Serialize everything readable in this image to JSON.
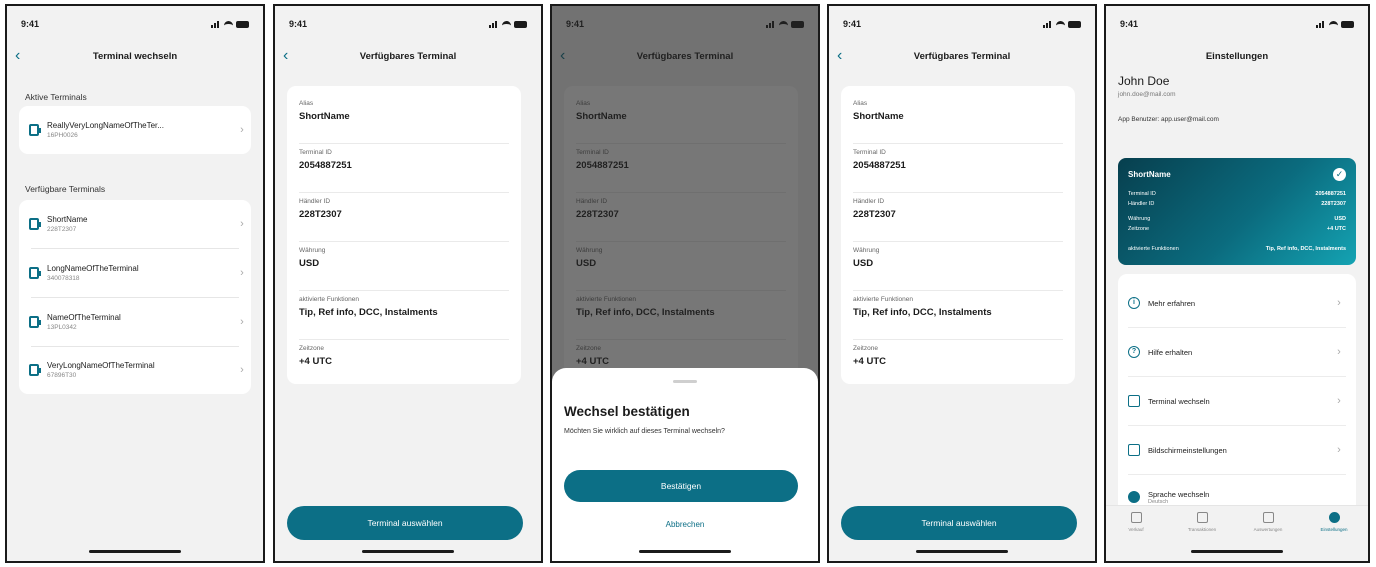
{
  "status_time": "9:41",
  "screen1": {
    "title": "Terminal wechseln",
    "active_label": "Aktive Terminals",
    "active": [
      {
        "name": "ReallyVeryLongNameOfTheTer...",
        "id": "16PH0026"
      }
    ],
    "available_label": "Verfügbare Terminals",
    "available": [
      {
        "name": "ShortName",
        "id": "228T2307"
      },
      {
        "name": "LongNameOfTheTerminal",
        "id": "340078318"
      },
      {
        "name": "NameOfTheTerminal",
        "id": "13PL0342"
      },
      {
        "name": "VeryLongNameOfTheTerminal",
        "id": "67896T30"
      }
    ]
  },
  "detail": {
    "title": "Verfügbares Terminal",
    "fields": [
      {
        "label": "Alias",
        "value": "ShortName"
      },
      {
        "label": "Terminal ID",
        "value": "2054887251"
      },
      {
        "label": "Händler ID",
        "value": "228T2307"
      },
      {
        "label": "Währung",
        "value": "USD"
      },
      {
        "label": "aktivierte Funktionen",
        "value": "Tip, Ref info, DCC, Instalments"
      },
      {
        "label": "Zeitzone",
        "value": "+4 UTC"
      }
    ],
    "button": "Terminal auswählen"
  },
  "sheet": {
    "title": "Wechsel bestätigen",
    "description": "Möchten Sie wirklich auf dieses Terminal wechseln?",
    "confirm": "Bestätigen",
    "cancel": "Abbrechen"
  },
  "settings": {
    "title": "Einstellungen",
    "user_name": "John Doe",
    "user_email": "john.doe@mail.com",
    "app_user": "App Benutzer: app.user@mail.com",
    "card": {
      "name": "ShortName",
      "rows": [
        {
          "label": "Terminal ID",
          "value": "2054887251"
        },
        {
          "label": "Händler ID",
          "value": "228T2307"
        },
        {
          "label": "Währung",
          "value": "USD"
        },
        {
          "label": "Zeitzone",
          "value": "+4 UTC"
        },
        {
          "label": "aktivierte Funktionen",
          "value": "Tip, Ref info, DCC, Instalments"
        }
      ]
    },
    "menu": [
      {
        "label": "Mehr erfahren",
        "icon": "info-icon"
      },
      {
        "label": "Hilfe erhalten",
        "icon": "help-icon"
      },
      {
        "label": "Terminal wechseln",
        "icon": "terminal-icon"
      },
      {
        "label": "Bildschirmeinstellungen",
        "icon": "display-settings-icon"
      },
      {
        "label": "Sprache wechseln",
        "sub": "Deutsch",
        "icon": "globe-icon"
      }
    ],
    "tabs": [
      "Verkauf",
      "Transaktionen",
      "Auswertungen",
      "Einstellungen"
    ]
  },
  "colors": {
    "accent": "#0c6f86",
    "background": "#f2f2f2"
  }
}
